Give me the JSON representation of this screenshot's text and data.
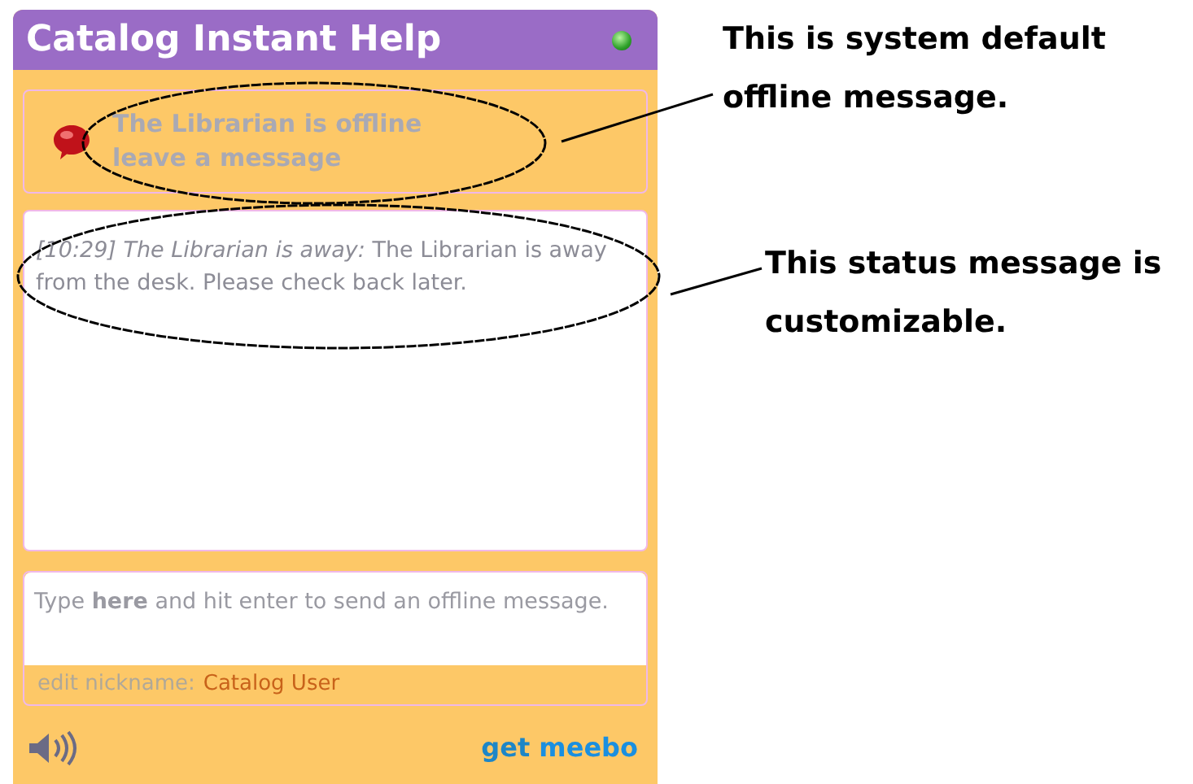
{
  "widget": {
    "title": "Catalog Instant Help",
    "offline_notice": [
      "The Librarian is offline",
      "leave a message"
    ],
    "messages": [
      {
        "text": "*[10:29] The Librarian is away:* The Librarian is away from the desk.  Please check back later."
      }
    ],
    "input": {
      "placeholder": "Type **here** and hit enter to send an offline message."
    },
    "nickname": {
      "label": "edit nickname:",
      "value": "Catalog User"
    },
    "logo": {
      "prefix": "get",
      "name": "meebo"
    }
  },
  "annotations": [
    {
      "text": "This is system default offline message."
    },
    {
      "text": "This status message is customizable."
    }
  ]
}
